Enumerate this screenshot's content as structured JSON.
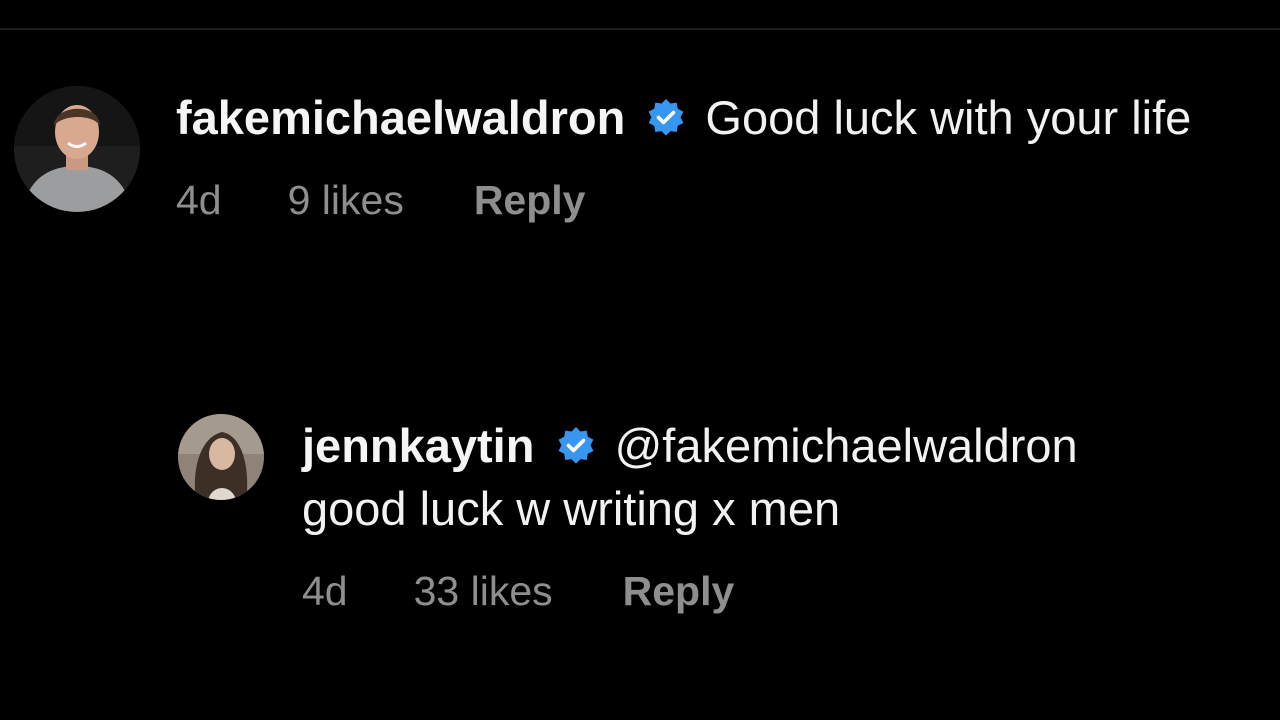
{
  "comments": [
    {
      "username": "fakemichaelwaldron",
      "verified": true,
      "text": "Good luck with your life",
      "timestamp": "4d",
      "likes": "9 likes",
      "reply_label": "Reply"
    },
    {
      "username": "jennkaytin",
      "verified": true,
      "mention": "@fakemichaelwaldron",
      "text": "good luck w writing x men",
      "timestamp": "4d",
      "likes": "33 likes",
      "reply_label": "Reply"
    }
  ],
  "colors": {
    "background": "#000000",
    "text": "#f2f2f2",
    "meta": "#8e8e8e",
    "verified": "#3797f0"
  },
  "icons": {
    "verified": "verified-badge-icon"
  }
}
